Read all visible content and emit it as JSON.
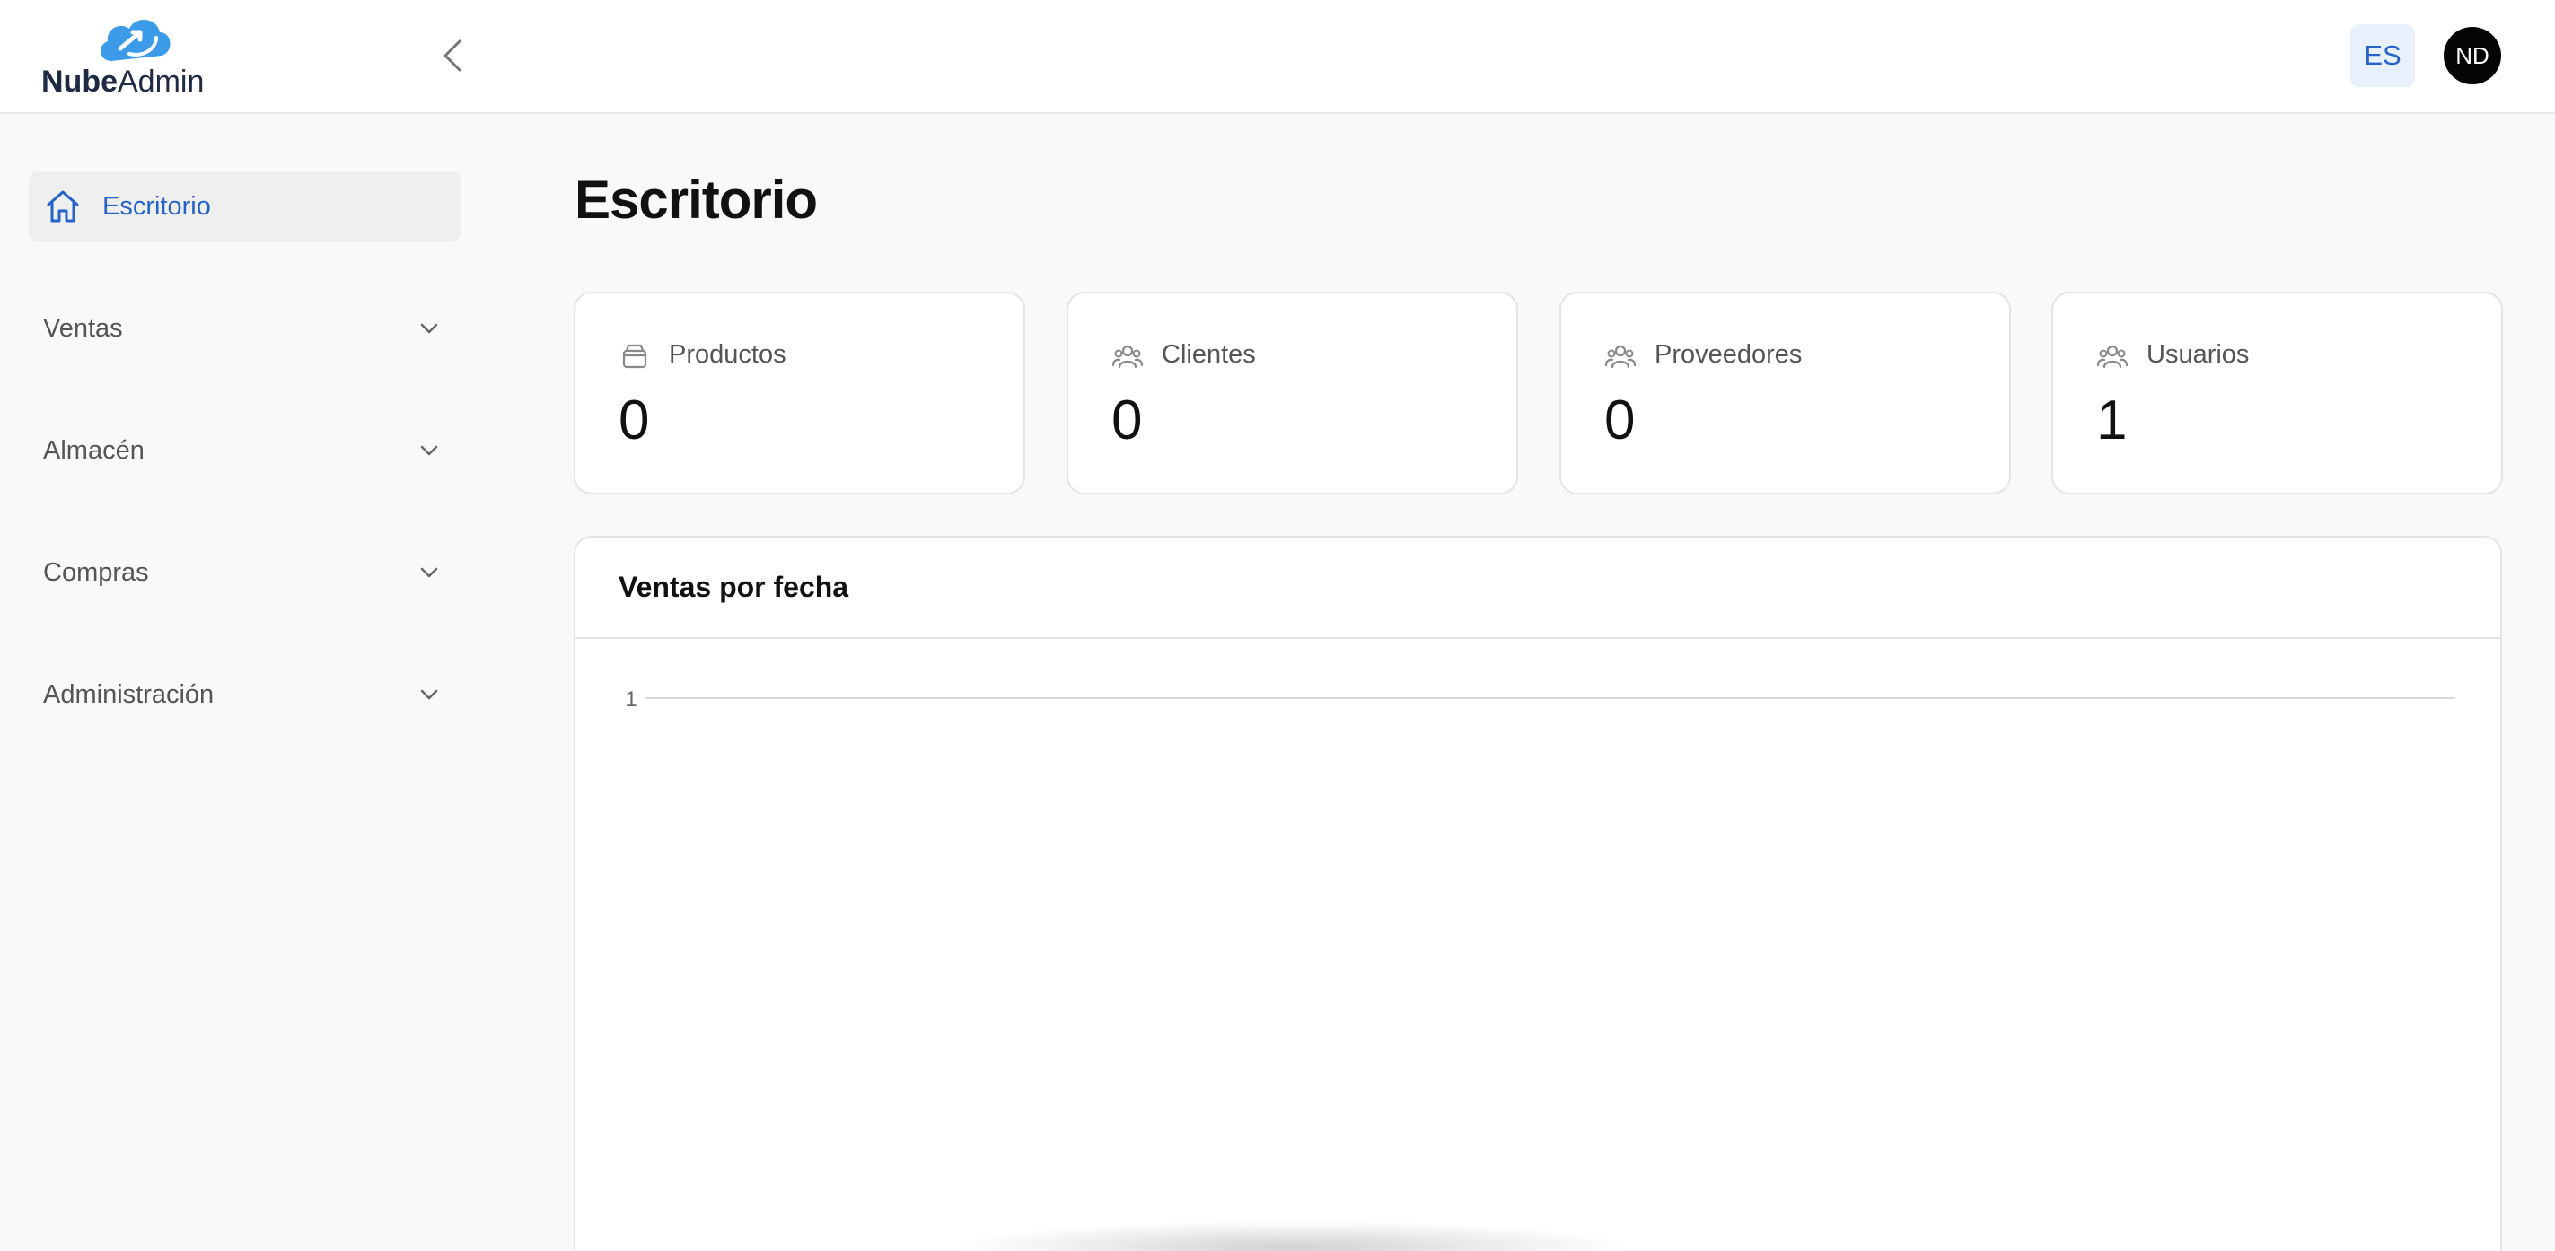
{
  "header": {
    "logo": {
      "word1": "Nube",
      "word2": "Admin"
    },
    "language": "ES",
    "avatar_initials": "ND",
    "icons": {
      "collapse": "chevron-left-icon",
      "logo": "cloud-logo-icon"
    }
  },
  "sidebar": {
    "items": [
      {
        "label": "Escritorio",
        "icon": "home-icon",
        "active": true
      },
      {
        "label": "Ventas",
        "icon": "chevron-down-icon"
      },
      {
        "label": "Almacén",
        "icon": "chevron-down-icon"
      },
      {
        "label": "Compras",
        "icon": "chevron-down-icon"
      },
      {
        "label": "Administración",
        "icon": "chevron-down-icon"
      }
    ]
  },
  "main": {
    "title": "Escritorio",
    "stats": [
      {
        "label": "Productos",
        "value": "0",
        "icon": "archive-box-icon"
      },
      {
        "label": "Clientes",
        "value": "0",
        "icon": "users-icon"
      },
      {
        "label": "Proveedores",
        "value": "0",
        "icon": "users-icon"
      },
      {
        "label": "Usuarios",
        "value": "1",
        "icon": "users-icon"
      }
    ],
    "chart": {
      "title": "Ventas por fecha"
    }
  },
  "chart_data": {
    "type": "line",
    "title": "Ventas por fecha",
    "x": [],
    "series": [],
    "yticks": [
      "1"
    ],
    "grid": true
  },
  "colors": {
    "accent": "#2563c9",
    "logo_blue": "#3b9be8",
    "logo_text": "#1f2a44"
  }
}
